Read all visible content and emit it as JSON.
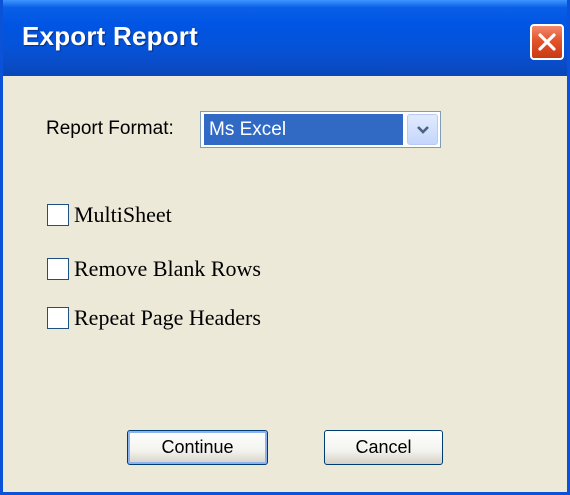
{
  "window": {
    "title": "Export Report"
  },
  "form": {
    "report_format_label": "Report Format:",
    "report_format_value": "Ms Excel"
  },
  "options": [
    {
      "label": "MultiSheet",
      "checked": false
    },
    {
      "label": "Remove Blank Rows",
      "checked": false
    },
    {
      "label": "Repeat Page Headers",
      "checked": false
    }
  ],
  "buttons": {
    "continue": "Continue",
    "cancel": "Cancel"
  },
  "colors": {
    "titlebar": "#0055e4",
    "dialog_bg": "#ece9d8",
    "selection": "#316ac5",
    "close": "#e2542b"
  },
  "icons": {
    "close": "close-icon",
    "dropdown": "chevron-down-icon"
  }
}
